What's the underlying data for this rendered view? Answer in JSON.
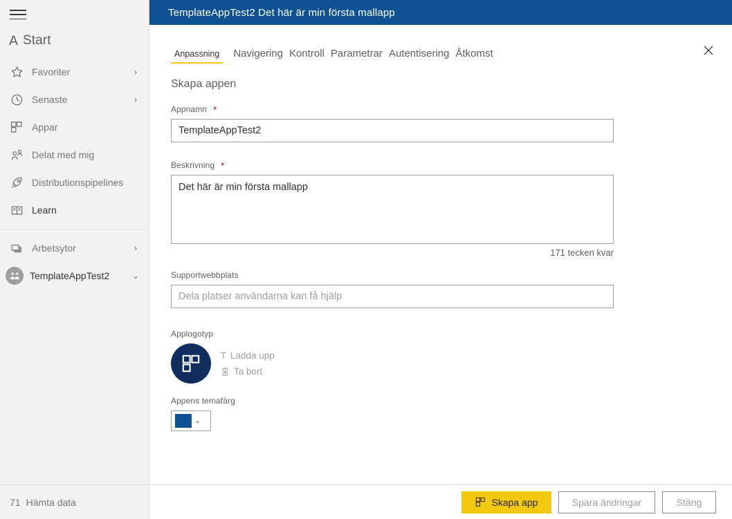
{
  "sidebar": {
    "hamburger_name": "hamburger-menu",
    "brand": {
      "glyph": "A",
      "label": "Start"
    },
    "items": [
      {
        "label": "Favoriter",
        "icon": "star-icon",
        "chevron": "›",
        "strong": false
      },
      {
        "label": "Senaste",
        "icon": "clock-icon",
        "chevron": "›",
        "strong": false
      },
      {
        "label": "Appar",
        "icon": "apps-grid-icon",
        "chevron": "",
        "strong": false
      },
      {
        "label": "Delat med mig",
        "icon": "shared-with-me-icon",
        "chevron": "",
        "strong": false
      },
      {
        "label": "Distributionspipelines",
        "icon": "rocket-icon",
        "chevron": "",
        "strong": false
      },
      {
        "label": "Learn",
        "icon": "book-icon",
        "chevron": "",
        "strong": true
      }
    ],
    "workspace_items": [
      {
        "label": "Arbetsytor",
        "icon": "workspaces-icon",
        "chevron": "›",
        "avatar": false
      },
      {
        "label": "TemplateAppTest2",
        "icon": "workspace-avatar-icon",
        "chevron": "⌄",
        "avatar": true
      }
    ],
    "get_data": {
      "glyph": "71",
      "label": "Hämta data"
    }
  },
  "header": {
    "title": "TemplateAppTest2 Det här är min första mallapp",
    "background": "#0e5293"
  },
  "tabs": {
    "active": "Anpassning",
    "items": [
      {
        "label": "Anpassning",
        "active": true
      },
      {
        "label": "Navigering",
        "active": false
      },
      {
        "label": "Kontroll",
        "active": false
      },
      {
        "label": "Parametrar",
        "active": false
      },
      {
        "label": "Autentisering",
        "active": false
      },
      {
        "label": "Åtkomst",
        "active": false
      }
    ],
    "accent": "#f2c811"
  },
  "close_button": {
    "name": "close-icon",
    "label": "✕"
  },
  "form": {
    "section_title": "Skapa appen",
    "app_name": {
      "label": "Appnamn",
      "required_mark": "*",
      "value": "TemplateAppTest2",
      "placeholder": ""
    },
    "description": {
      "label": "Beskrivning",
      "required_mark": "*",
      "value": "Det här är min första mallapp",
      "placeholder": "",
      "counter": "171 tecken kvar"
    },
    "support_site": {
      "label": "Supportwebbplats",
      "value": "",
      "placeholder": "Dela platser användarna kan få hjälp"
    },
    "app_logo": {
      "label": "Applogotyp",
      "upload_glyph": "T",
      "upload_label": "Ladda upp",
      "remove_label": "Ta bort",
      "logo_background": "#112d5e"
    },
    "theme_color": {
      "label": "Appens temafärg",
      "value": "#0e5293",
      "chevron": "⌄"
    }
  },
  "footer": {
    "create_app": {
      "label": "Skapa app",
      "icon": "apps-grid-icon"
    },
    "save_changes": {
      "label": "Spara ändringar"
    },
    "close": {
      "label": "Stäng"
    }
  }
}
